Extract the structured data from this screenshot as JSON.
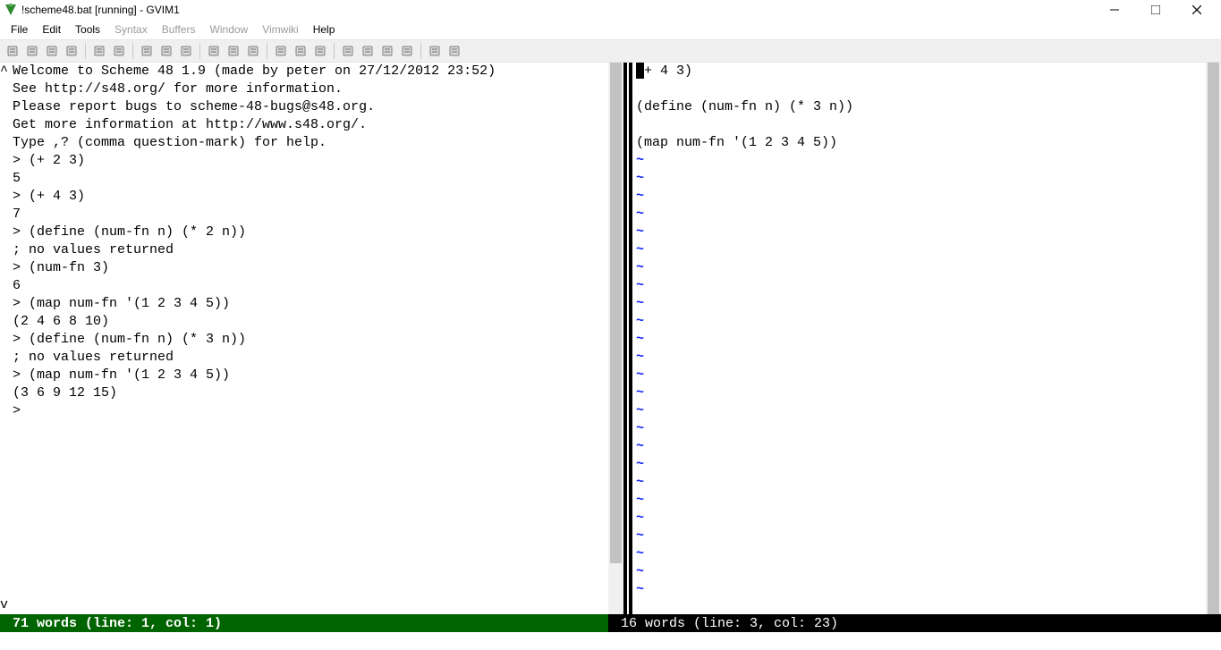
{
  "window": {
    "title": "!scheme48.bat [running] - GVIM1"
  },
  "menu": {
    "items": [
      {
        "label": "File",
        "disabled": false
      },
      {
        "label": "Edit",
        "disabled": false
      },
      {
        "label": "Tools",
        "disabled": false
      },
      {
        "label": "Syntax",
        "disabled": true
      },
      {
        "label": "Buffers",
        "disabled": true
      },
      {
        "label": "Window",
        "disabled": true
      },
      {
        "label": "Vimwiki",
        "disabled": true
      },
      {
        "label": "Help",
        "disabled": false
      }
    ]
  },
  "toolbar": {
    "icons": [
      "file-open-icon",
      "save-icon",
      "save-all-icon",
      "print-icon",
      "sep",
      "undo-icon",
      "redo-icon",
      "sep",
      "cut-icon",
      "copy-icon",
      "paste-icon",
      "sep",
      "find-replace-icon",
      "find-next-icon",
      "find-prev-icon",
      "sep",
      "load-session-icon",
      "save-session-icon",
      "run-script-icon",
      "sep",
      "make-icon",
      "shell-icon",
      "tags-build-icon",
      "tags-jump-icon",
      "sep",
      "help-icon",
      "find-help-icon"
    ]
  },
  "left_pane": {
    "fold_marker_top": "^",
    "fold_marker_bottom": "v",
    "lines": [
      "Welcome to Scheme 48 1.9 (made by peter on 27/12/2012 23:52)",
      "See http://s48.org/ for more information.",
      "Please report bugs to scheme-48-bugs@s48.org.",
      "Get more information at http://www.s48.org/.",
      "Type ,? (comma question-mark) for help.",
      "> (+ 2 3)",
      "5",
      "> (+ 4 3)",
      "7",
      "> (define (num-fn n) (* 2 n))",
      "; no values returned",
      "> (num-fn 3)",
      "6",
      "> (map num-fn '(1 2 3 4 5))",
      "(2 4 6 8 10)",
      "> (define (num-fn n) (* 3 n))",
      "; no values returned",
      "> (map num-fn '(1 2 3 4 5))",
      "(3 6 9 12 15)",
      "> "
    ],
    "status": "71 words (line: 1, col: 1)"
  },
  "right_pane": {
    "lines": [
      "(+ 4 3)",
      "",
      "(define (num-fn n) (* 3 n))",
      "",
      "(map num-fn '(1 2 3 4 5))"
    ],
    "tilde": "~",
    "tilde_count": 25,
    "status": "16 words (line: 3, col: 23)"
  }
}
